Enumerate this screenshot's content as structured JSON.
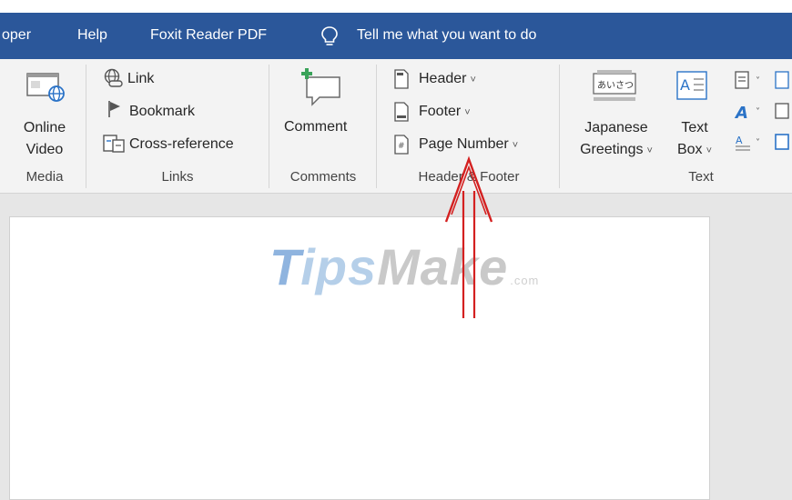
{
  "menubar": {
    "tabs": [
      "oper",
      "Help",
      "Foxit Reader PDF"
    ],
    "tell_me": "Tell me what you want to do"
  },
  "ribbon": {
    "media": {
      "button_line1": "Online",
      "button_line2": "Video",
      "group": "Media"
    },
    "links": {
      "items": [
        "Link",
        "Bookmark",
        "Cross-reference"
      ],
      "group": "Links"
    },
    "comments": {
      "button": "Comment",
      "group": "Comments"
    },
    "header_footer": {
      "items": [
        "Header",
        "Footer",
        "Page Number"
      ],
      "group": "Header & Footer"
    },
    "text": {
      "japanese_line1": "Japanese",
      "japanese_line2": "Greetings",
      "japanese_icon_text": "あいさつ",
      "textbox_line1": "Text",
      "textbox_line2": "Box",
      "group": "Text"
    }
  },
  "watermark": {
    "t": "T",
    "ips": "ips",
    "make": "Make",
    "com": ".com"
  },
  "colors": {
    "menubar": "#2b579a",
    "ribbon": "#f3f3f3",
    "arrow": "#d42020",
    "page": "#ffffff"
  },
  "icons": [
    "lightbulb-icon",
    "online-video-icon",
    "link-icon",
    "bookmark-icon",
    "cross-reference-icon",
    "comment-icon",
    "header-icon",
    "footer-icon",
    "page-number-icon",
    "japanese-greetings-icon",
    "text-box-icon",
    "quick-parts-icon",
    "wordart-icon",
    "dropcap-icon"
  ]
}
